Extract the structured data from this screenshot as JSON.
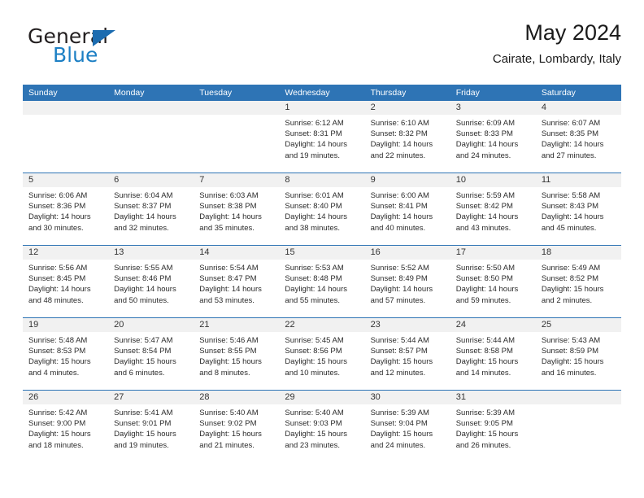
{
  "brand": {
    "name_top": "General",
    "name_bottom": "Blue",
    "triangle_color": "#1c6cb0",
    "blue_text_color": "#1c7fc4"
  },
  "header": {
    "title": "May 2024",
    "subtitle": "Cairate, Lombardy, Italy"
  },
  "theme": {
    "header_bg": "#2e74b5",
    "header_text": "#ffffff",
    "day_band_bg": "#f1f1f1",
    "cell_bg": "#ffffff",
    "week_divider": "#2e74b5"
  },
  "weekdays": [
    "Sunday",
    "Monday",
    "Tuesday",
    "Wednesday",
    "Thursday",
    "Friday",
    "Saturday"
  ],
  "labels": {
    "sunrise_prefix": "Sunrise:",
    "sunset_prefix": "Sunset:",
    "daylight_prefix": "Daylight:"
  },
  "weeks": [
    [
      {
        "day": "",
        "sunrise": "",
        "sunset": "",
        "daylight_line1": "",
        "daylight_line2": "",
        "empty": true
      },
      {
        "day": "",
        "sunrise": "",
        "sunset": "",
        "daylight_line1": "",
        "daylight_line2": "",
        "empty": true
      },
      {
        "day": "",
        "sunrise": "",
        "sunset": "",
        "daylight_line1": "",
        "daylight_line2": "",
        "empty": true
      },
      {
        "day": "1",
        "sunrise": "Sunrise: 6:12 AM",
        "sunset": "Sunset: 8:31 PM",
        "daylight_line1": "Daylight: 14 hours",
        "daylight_line2": "and 19 minutes."
      },
      {
        "day": "2",
        "sunrise": "Sunrise: 6:10 AM",
        "sunset": "Sunset: 8:32 PM",
        "daylight_line1": "Daylight: 14 hours",
        "daylight_line2": "and 22 minutes."
      },
      {
        "day": "3",
        "sunrise": "Sunrise: 6:09 AM",
        "sunset": "Sunset: 8:33 PM",
        "daylight_line1": "Daylight: 14 hours",
        "daylight_line2": "and 24 minutes."
      },
      {
        "day": "4",
        "sunrise": "Sunrise: 6:07 AM",
        "sunset": "Sunset: 8:35 PM",
        "daylight_line1": "Daylight: 14 hours",
        "daylight_line2": "and 27 minutes."
      }
    ],
    [
      {
        "day": "5",
        "sunrise": "Sunrise: 6:06 AM",
        "sunset": "Sunset: 8:36 PM",
        "daylight_line1": "Daylight: 14 hours",
        "daylight_line2": "and 30 minutes."
      },
      {
        "day": "6",
        "sunrise": "Sunrise: 6:04 AM",
        "sunset": "Sunset: 8:37 PM",
        "daylight_line1": "Daylight: 14 hours",
        "daylight_line2": "and 32 minutes."
      },
      {
        "day": "7",
        "sunrise": "Sunrise: 6:03 AM",
        "sunset": "Sunset: 8:38 PM",
        "daylight_line1": "Daylight: 14 hours",
        "daylight_line2": "and 35 minutes."
      },
      {
        "day": "8",
        "sunrise": "Sunrise: 6:01 AM",
        "sunset": "Sunset: 8:40 PM",
        "daylight_line1": "Daylight: 14 hours",
        "daylight_line2": "and 38 minutes."
      },
      {
        "day": "9",
        "sunrise": "Sunrise: 6:00 AM",
        "sunset": "Sunset: 8:41 PM",
        "daylight_line1": "Daylight: 14 hours",
        "daylight_line2": "and 40 minutes."
      },
      {
        "day": "10",
        "sunrise": "Sunrise: 5:59 AM",
        "sunset": "Sunset: 8:42 PM",
        "daylight_line1": "Daylight: 14 hours",
        "daylight_line2": "and 43 minutes."
      },
      {
        "day": "11",
        "sunrise": "Sunrise: 5:58 AM",
        "sunset": "Sunset: 8:43 PM",
        "daylight_line1": "Daylight: 14 hours",
        "daylight_line2": "and 45 minutes."
      }
    ],
    [
      {
        "day": "12",
        "sunrise": "Sunrise: 5:56 AM",
        "sunset": "Sunset: 8:45 PM",
        "daylight_line1": "Daylight: 14 hours",
        "daylight_line2": "and 48 minutes."
      },
      {
        "day": "13",
        "sunrise": "Sunrise: 5:55 AM",
        "sunset": "Sunset: 8:46 PM",
        "daylight_line1": "Daylight: 14 hours",
        "daylight_line2": "and 50 minutes."
      },
      {
        "day": "14",
        "sunrise": "Sunrise: 5:54 AM",
        "sunset": "Sunset: 8:47 PM",
        "daylight_line1": "Daylight: 14 hours",
        "daylight_line2": "and 53 minutes."
      },
      {
        "day": "15",
        "sunrise": "Sunrise: 5:53 AM",
        "sunset": "Sunset: 8:48 PM",
        "daylight_line1": "Daylight: 14 hours",
        "daylight_line2": "and 55 minutes."
      },
      {
        "day": "16",
        "sunrise": "Sunrise: 5:52 AM",
        "sunset": "Sunset: 8:49 PM",
        "daylight_line1": "Daylight: 14 hours",
        "daylight_line2": "and 57 minutes."
      },
      {
        "day": "17",
        "sunrise": "Sunrise: 5:50 AM",
        "sunset": "Sunset: 8:50 PM",
        "daylight_line1": "Daylight: 14 hours",
        "daylight_line2": "and 59 minutes."
      },
      {
        "day": "18",
        "sunrise": "Sunrise: 5:49 AM",
        "sunset": "Sunset: 8:52 PM",
        "daylight_line1": "Daylight: 15 hours",
        "daylight_line2": "and 2 minutes."
      }
    ],
    [
      {
        "day": "19",
        "sunrise": "Sunrise: 5:48 AM",
        "sunset": "Sunset: 8:53 PM",
        "daylight_line1": "Daylight: 15 hours",
        "daylight_line2": "and 4 minutes."
      },
      {
        "day": "20",
        "sunrise": "Sunrise: 5:47 AM",
        "sunset": "Sunset: 8:54 PM",
        "daylight_line1": "Daylight: 15 hours",
        "daylight_line2": "and 6 minutes."
      },
      {
        "day": "21",
        "sunrise": "Sunrise: 5:46 AM",
        "sunset": "Sunset: 8:55 PM",
        "daylight_line1": "Daylight: 15 hours",
        "daylight_line2": "and 8 minutes."
      },
      {
        "day": "22",
        "sunrise": "Sunrise: 5:45 AM",
        "sunset": "Sunset: 8:56 PM",
        "daylight_line1": "Daylight: 15 hours",
        "daylight_line2": "and 10 minutes."
      },
      {
        "day": "23",
        "sunrise": "Sunrise: 5:44 AM",
        "sunset": "Sunset: 8:57 PM",
        "daylight_line1": "Daylight: 15 hours",
        "daylight_line2": "and 12 minutes."
      },
      {
        "day": "24",
        "sunrise": "Sunrise: 5:44 AM",
        "sunset": "Sunset: 8:58 PM",
        "daylight_line1": "Daylight: 15 hours",
        "daylight_line2": "and 14 minutes."
      },
      {
        "day": "25",
        "sunrise": "Sunrise: 5:43 AM",
        "sunset": "Sunset: 8:59 PM",
        "daylight_line1": "Daylight: 15 hours",
        "daylight_line2": "and 16 minutes."
      }
    ],
    [
      {
        "day": "26",
        "sunrise": "Sunrise: 5:42 AM",
        "sunset": "Sunset: 9:00 PM",
        "daylight_line1": "Daylight: 15 hours",
        "daylight_line2": "and 18 minutes."
      },
      {
        "day": "27",
        "sunrise": "Sunrise: 5:41 AM",
        "sunset": "Sunset: 9:01 PM",
        "daylight_line1": "Daylight: 15 hours",
        "daylight_line2": "and 19 minutes."
      },
      {
        "day": "28",
        "sunrise": "Sunrise: 5:40 AM",
        "sunset": "Sunset: 9:02 PM",
        "daylight_line1": "Daylight: 15 hours",
        "daylight_line2": "and 21 minutes."
      },
      {
        "day": "29",
        "sunrise": "Sunrise: 5:40 AM",
        "sunset": "Sunset: 9:03 PM",
        "daylight_line1": "Daylight: 15 hours",
        "daylight_line2": "and 23 minutes."
      },
      {
        "day": "30",
        "sunrise": "Sunrise: 5:39 AM",
        "sunset": "Sunset: 9:04 PM",
        "daylight_line1": "Daylight: 15 hours",
        "daylight_line2": "and 24 minutes."
      },
      {
        "day": "31",
        "sunrise": "Sunrise: 5:39 AM",
        "sunset": "Sunset: 9:05 PM",
        "daylight_line1": "Daylight: 15 hours",
        "daylight_line2": "and 26 minutes."
      },
      {
        "day": "",
        "sunrise": "",
        "sunset": "",
        "daylight_line1": "",
        "daylight_line2": "",
        "empty": true
      }
    ]
  ]
}
